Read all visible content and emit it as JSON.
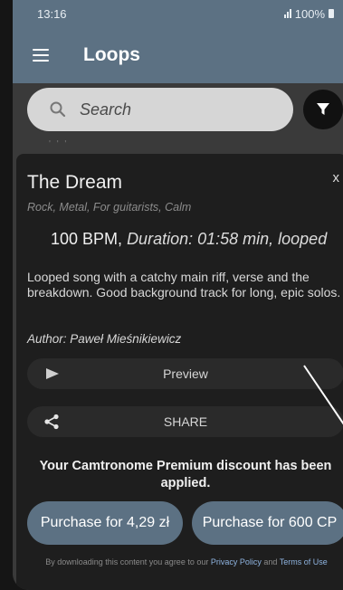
{
  "status_bar": {
    "time": "13:16",
    "battery": "100%"
  },
  "app_bar": {
    "title": "Loops",
    "menu_icon": "hamburger-menu-icon"
  },
  "search": {
    "placeholder": "Search",
    "icon": "search-icon"
  },
  "filter": {
    "icon": "filter-funnel-icon"
  },
  "detail": {
    "close_label": "x",
    "title": "The Dream",
    "tags": "Rock, Metal, For guitarists, Calm",
    "bpm": "100 BPM,",
    "duration_text": "Duration: 01:58 min, looped",
    "description": "Looped song with a catchy main riff, verse and the breakdown. Good background track for long, epic solos.",
    "author": "Author: Paweł Mieśnikiewicz",
    "preview_label": "Preview",
    "share_label": "SHARE",
    "discount_text": "Your Camtronome Premium discount has been applied.",
    "purchase_money_label": "Purchase for 4,29 zł",
    "purchase_cp_label": "Purchase for 600 CP",
    "legal_prefix": "By downloading this content you agree to our",
    "legal_privacy": "Privacy Policy",
    "legal_and": "and",
    "legal_terms": "Terms of Use"
  },
  "colors": {
    "accent": "#5c7183",
    "sheet_background": "#1e1e1e",
    "search_background": "#d6d6d6",
    "link": "#8fb4e0"
  }
}
